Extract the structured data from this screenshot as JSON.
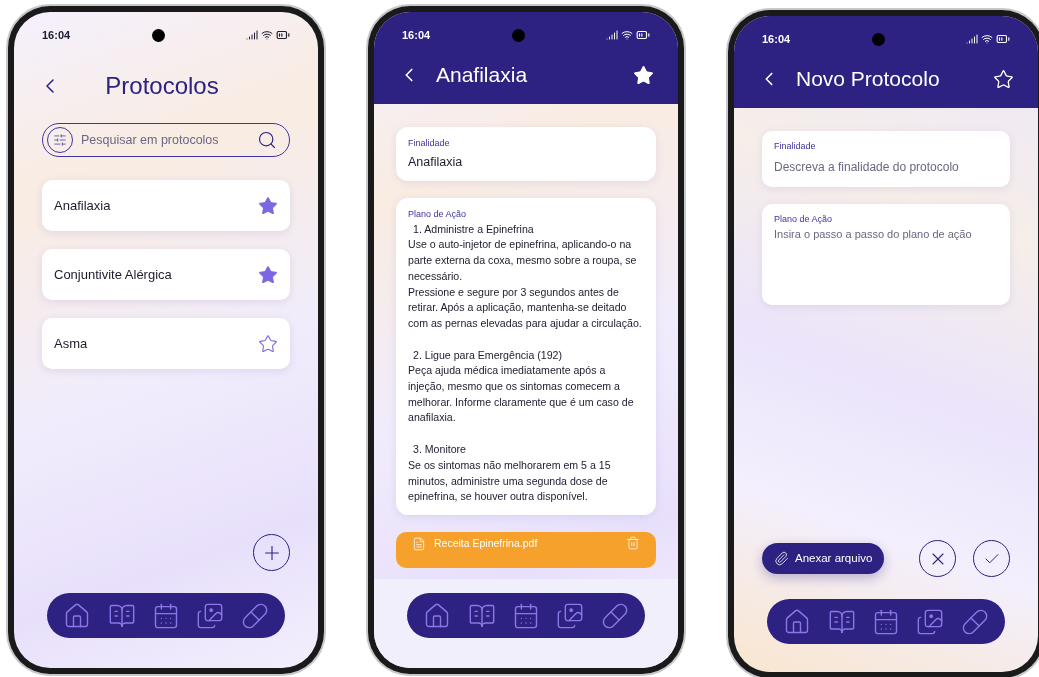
{
  "phones": [
    {
      "kind": "list",
      "time": "16:04",
      "title": "Protocolos",
      "search": {
        "placeholder": "Pesquisar em protocolos"
      },
      "items": [
        {
          "label": "Anafilaxia",
          "favorite": true
        },
        {
          "label": "Conjuntivite Alérgica",
          "favorite": true
        },
        {
          "label": "Asma",
          "favorite": false
        }
      ]
    },
    {
      "kind": "detail",
      "time": "16:04",
      "title": "Anafilaxia",
      "favorite": true,
      "purpose": {
        "label": "Finalidade",
        "value": "Anafilaxia"
      },
      "plan": {
        "label": "Plano de Ação",
        "sections": [
          {
            "heading": "1. Administre a Epinefrina",
            "paragraphs": [
              "Use o auto-injetor de epinefrina, aplicando-o na parte externa da coxa, mesmo sobre a roupa, se necessário.",
              "Pressione e segure por 3 segundos antes de retirar. Após a aplicação, mantenha-se deitado com as pernas elevadas para ajudar a circulação."
            ]
          },
          {
            "heading": "2. Ligue para Emergência (192)",
            "paragraphs": [
              "Peça ajuda médica imediatamente após a injeção, mesmo que os sintomas comecem a melhorar. Informe claramente que é um caso de anafilaxia."
            ]
          },
          {
            "heading": "3. Monitore",
            "paragraphs": [
              "Se os sintomas não melhorarem em 5 a 15 minutos, administre uma segunda dose de epinefrina, se houver outra disponível."
            ]
          }
        ]
      },
      "attachment": "Receita Epinefrina.pdf"
    },
    {
      "kind": "form",
      "time": "16:04",
      "title": "Novo Protocolo",
      "favorite": false,
      "purpose": {
        "label": "Finalidade",
        "placeholder": "Descreva a finalidade do protocolo"
      },
      "plan": {
        "label": "Plano de Ação",
        "placeholder": "Insira o passo a passo do plano de ação"
      },
      "attach_button": "Anexar arquivo"
    }
  ]
}
